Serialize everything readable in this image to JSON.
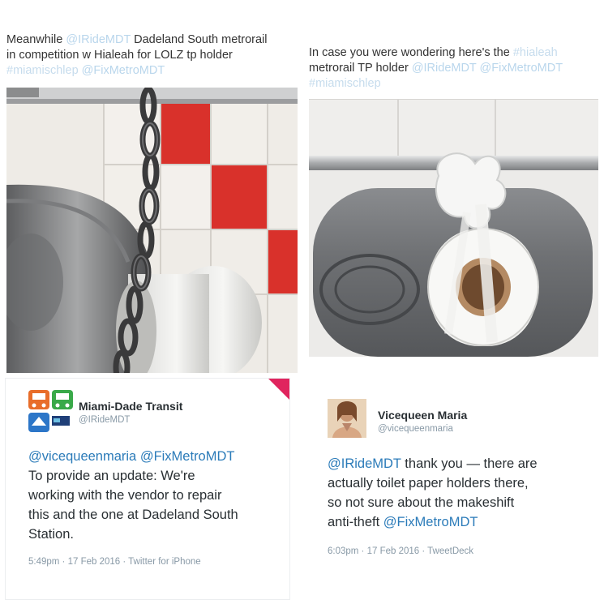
{
  "tweet_top_left": {
    "line1_prefix": "Meanwhile ",
    "line1_mention": "@IRideMDT",
    "line1_suffix": " Dadeland South metrorail",
    "line2": "in competition w Hialeah for LOLZ tp holder",
    "line3_tag": "#miamischlep",
    "line3_mention": " @FixMetroMDT"
  },
  "tweet_top_right": {
    "line1_prefix": "In case you were wondering here's the ",
    "line1_tag": "#hialeah",
    "line2_prefix": "metrorail TP holder ",
    "line2_mention1": "@IRideMDT",
    "line2_mention2": " @FixMetroMDT",
    "line3_tag": "#miamischlep"
  },
  "tweet_bottom_left": {
    "name": "Miami-Dade Transit",
    "handle": "@IRideMDT",
    "mentions": "@vicequeenmaria @FixMetroMDT",
    "line2": "To provide an update: We're",
    "line3": "working with the vendor to repair",
    "line4": "this and the one at Dadeland South",
    "line5": "Station.",
    "meta": "5:49pm · 17 Feb 2016 · Twitter for iPhone"
  },
  "tweet_bottom_right": {
    "name": "Vicequeen Maria",
    "handle": "@vicequeenmaria",
    "line1_mention": "@IRideMDT",
    "line1_text": " thank you — there are",
    "line2": "actually toilet paper holders there,",
    "line3": "so not sure about the makeshift",
    "line4_text": "anti-theft ",
    "line4_mention": "@FixMetroMDT",
    "meta": "6:03pm · 17 Feb 2016 · TweetDeck"
  },
  "colors": {
    "link": "#2b7bb9",
    "faded_link": "#b9d6ec",
    "tile_red": "#d9312b",
    "corner_pink": "#e0245e"
  },
  "icons": [
    "bus-icon",
    "train-icon",
    "heart-icon"
  ]
}
